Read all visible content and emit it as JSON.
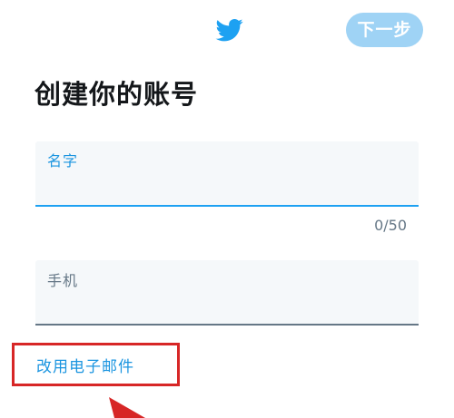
{
  "header": {
    "logo_icon": "twitter-bird-icon",
    "next_label": "下一步",
    "brand_color": "#1da1f2",
    "next_button_color": "#9fd3f5"
  },
  "page": {
    "title": "创建你的账号"
  },
  "form": {
    "name_label": "名字",
    "name_value": "",
    "name_counter": "0/50",
    "phone_label": "手机",
    "phone_value": ""
  },
  "alt_action": {
    "use_email_label": "改用电子邮件"
  },
  "annotation": {
    "highlight_color": "#d72626",
    "arrow_icon": "red-arrow"
  }
}
